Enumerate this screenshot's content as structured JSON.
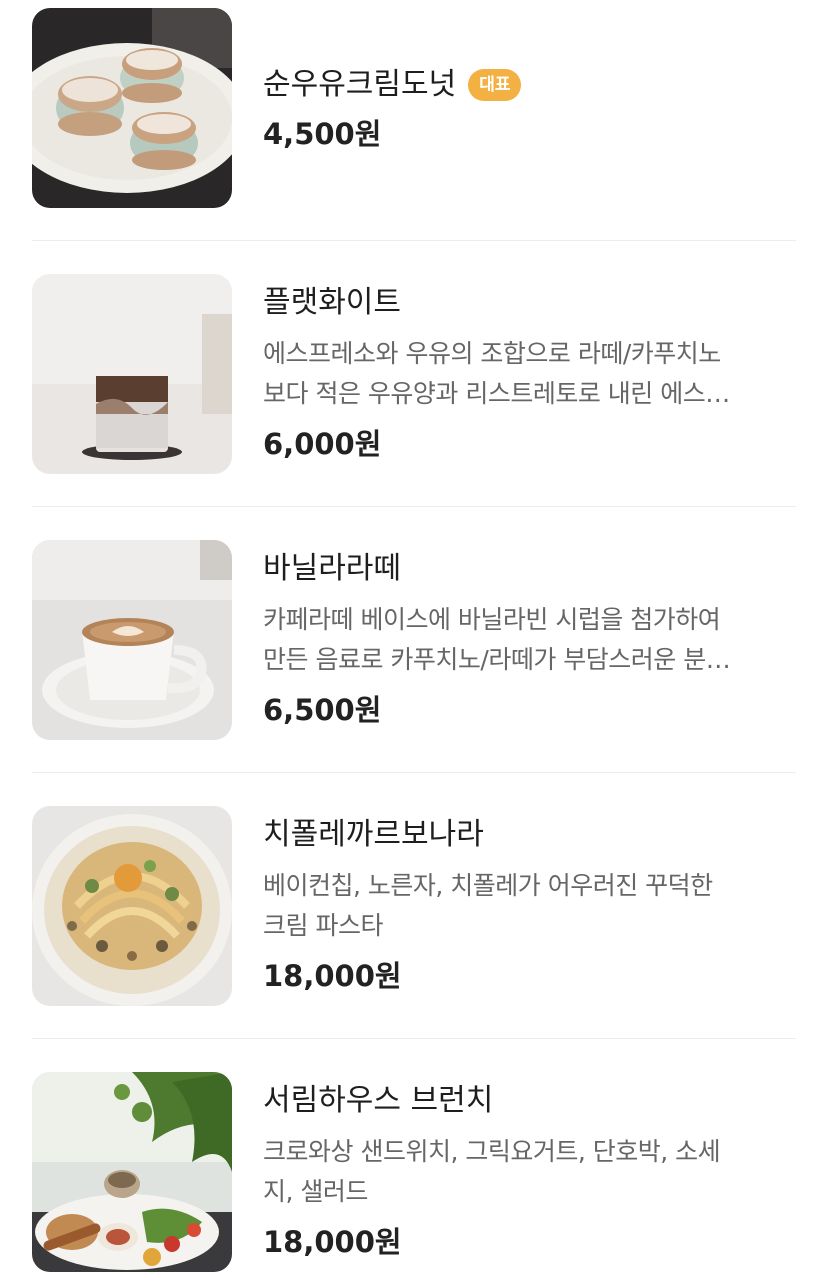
{
  "menu": {
    "items": [
      {
        "name": "순우유크림도넛",
        "badge": "대표",
        "price": "4,500원"
      },
      {
        "name": "플랫화이트",
        "description_lines": [
          "에스프레소와 우유의 조합으로 라떼/카푸치노",
          "보다 적은 우유양과 리스트레토로 내린 에스…"
        ],
        "price": "6,000원"
      },
      {
        "name": "바닐라라떼",
        "description_lines": [
          "카페라떼 베이스에 바닐라빈 시럽을 첨가하여",
          "만든 음료로 카푸치노/라떼가 부담스러운 분…"
        ],
        "price": "6,500원"
      },
      {
        "name": "치폴레까르보나라",
        "description_lines": [
          "베이컨칩, 노른자, 치폴레가 어우러진 꾸덕한",
          "크림 파스타"
        ],
        "price": "18,000원"
      },
      {
        "name": "서림하우스 브런치",
        "description_lines": [
          "크로와상 샌드위치, 그릭요거트, 단호박, 소세",
          "지, 샐러드"
        ],
        "price": "18,000원"
      }
    ]
  },
  "colors": {
    "badge_bg": "#f2b142",
    "divider": "#ececec",
    "description_text": "#666666",
    "title_text": "#1e1e1e"
  }
}
